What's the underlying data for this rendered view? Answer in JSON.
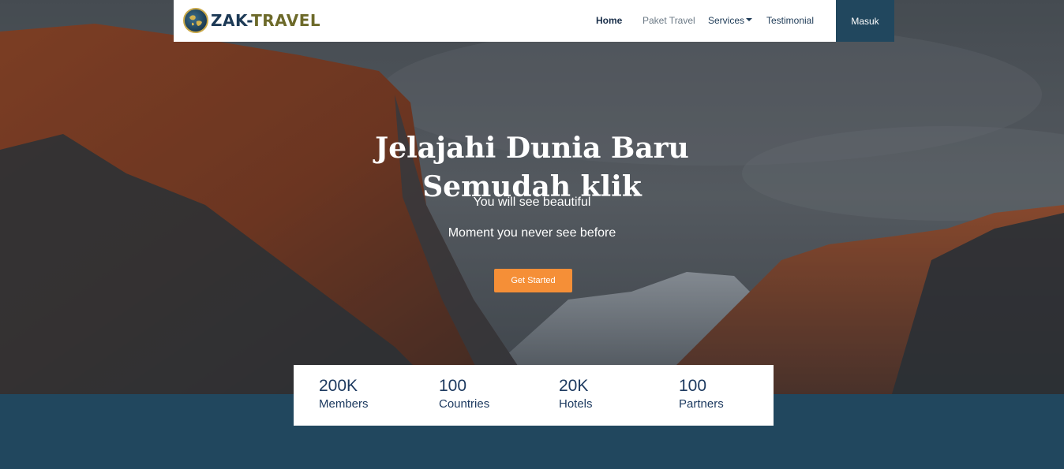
{
  "brand": {
    "name_part1": "ZAK-",
    "name_part2": "TRAVEL",
    "logo_icon": "globe-icon"
  },
  "nav": {
    "items": [
      {
        "label": "Home",
        "state": "active"
      },
      {
        "label": "Paket Travel",
        "state": "muted"
      },
      {
        "label": "Services",
        "state": "dropdown"
      },
      {
        "label": "Testimonial",
        "state": "normal"
      }
    ],
    "login_label": "Masuk"
  },
  "hero": {
    "title_line1": "Jelajahi Dunia Baru",
    "title_line2": "Semudah klik",
    "subtitle_line1": "You will see beautiful",
    "subtitle_line2": "Moment you never see before",
    "cta_label": "Get Started",
    "background": "mountain-landscape-photo"
  },
  "stats": [
    {
      "value": "200K",
      "label": "Members"
    },
    {
      "value": "100",
      "label": "Countries"
    },
    {
      "value": "20K",
      "label": "Hotels"
    },
    {
      "value": "100",
      "label": "Partners"
    }
  ],
  "colors": {
    "primary": "#21475e",
    "accent": "#f58f37",
    "text_dark": "#1d3a60"
  }
}
